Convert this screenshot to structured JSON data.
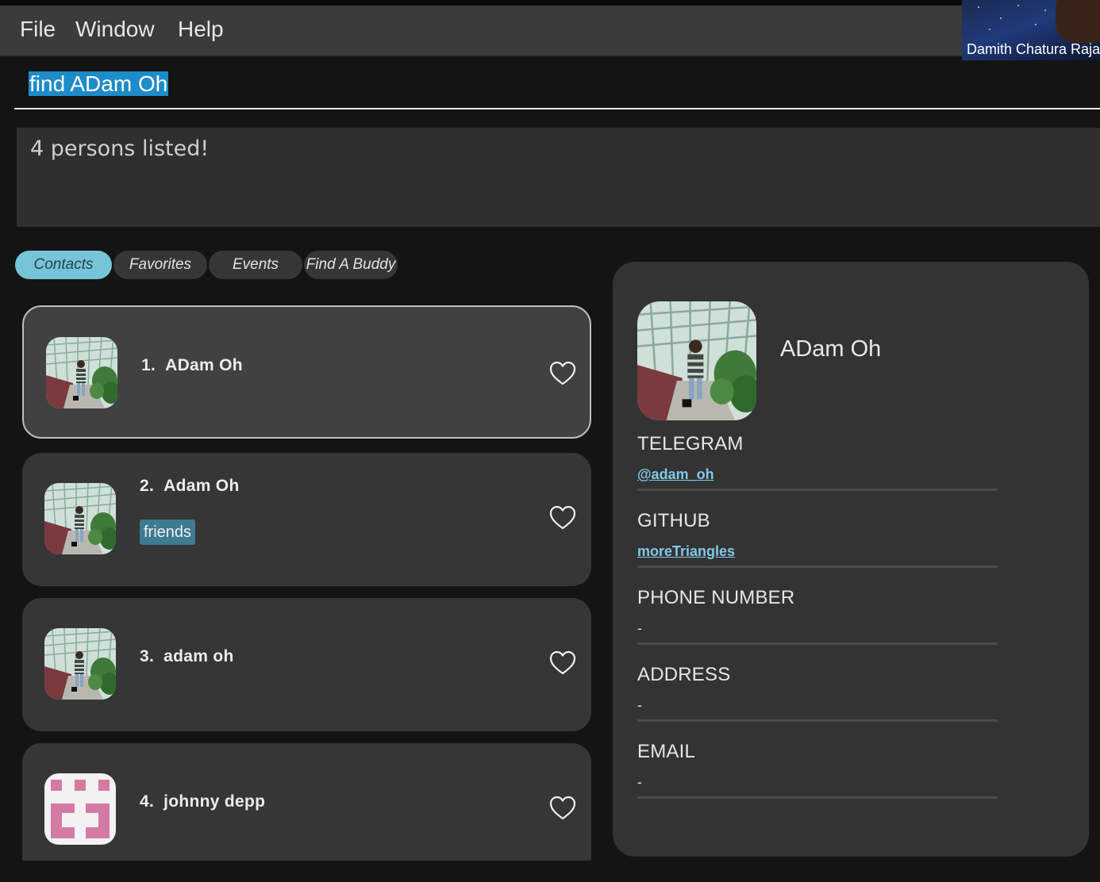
{
  "menu": {
    "file": "File",
    "window": "Window",
    "help": "Help"
  },
  "webcam": {
    "name": "Damith Chatura Raja"
  },
  "command": {
    "value": "find ADam Oh"
  },
  "result": {
    "message": "4 persons listed!"
  },
  "tabs": [
    {
      "label": "Contacts",
      "active": true
    },
    {
      "label": "Favorites",
      "active": false
    },
    {
      "label": "Events",
      "active": false
    },
    {
      "label": "Find A Buddy",
      "active": false
    }
  ],
  "persons": [
    {
      "index": "1.",
      "name": "ADam Oh",
      "tags": [],
      "avatar": "photo-icon",
      "selected": true
    },
    {
      "index": "2.",
      "name": "Adam Oh",
      "tags": [
        "friends"
      ],
      "avatar": "photo-icon",
      "selected": false
    },
    {
      "index": "3.",
      "name": "adam oh",
      "tags": [],
      "avatar": "photo-icon",
      "selected": false
    },
    {
      "index": "4.",
      "name": "johnny depp",
      "tags": [],
      "avatar": "identicon-icon",
      "selected": false
    }
  ],
  "detail": {
    "name": "ADam Oh",
    "fields": [
      {
        "label": "TELEGRAM",
        "value": "@adam_oh",
        "link": true
      },
      {
        "label": "GITHUB",
        "value": "moreTriangles",
        "link": true
      },
      {
        "label": "PHONE NUMBER",
        "value": "-",
        "link": false
      },
      {
        "label": "ADDRESS",
        "value": "-",
        "link": false
      },
      {
        "label": "EMAIL",
        "value": "-",
        "link": false
      }
    ]
  },
  "icons": {
    "favorite": "heart-outline-icon"
  },
  "colors": {
    "accent": "#76c4d8",
    "tag": "#3e7a90",
    "selection": "#1d8cc8",
    "link": "#7fc9e6",
    "identicon": "#d47aa4"
  }
}
